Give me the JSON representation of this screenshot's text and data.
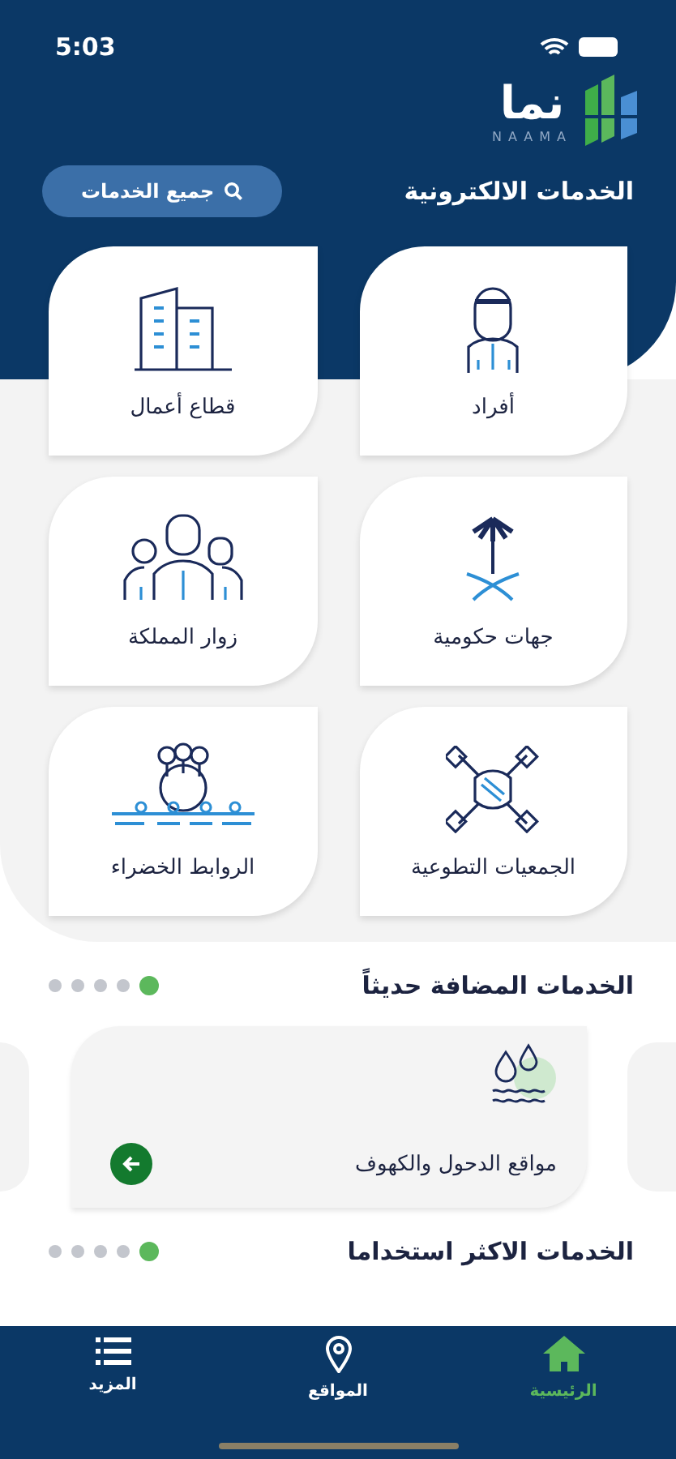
{
  "status_bar": {
    "time": "5:03"
  },
  "logo": {
    "arabic": "نما",
    "latin": "NAAMA"
  },
  "eservices": {
    "title": "الخدمات الالكترونية",
    "all_button": "جميع الخدمات"
  },
  "categories": [
    {
      "label": "أفراد",
      "kind": "person"
    },
    {
      "label": "قطاع أعمال",
      "kind": "building"
    },
    {
      "label": "جهات حكومية",
      "kind": "emblem"
    },
    {
      "label": "زوار المملكة",
      "kind": "family"
    },
    {
      "label": "الجمعيات التطوعية",
      "kind": "hands"
    },
    {
      "label": "الروابط الخضراء",
      "kind": "trees"
    }
  ],
  "new_services": {
    "title": "الخدمات المضافة حديثاً",
    "pages": [
      {
        "selected": true
      },
      {
        "selected": false
      },
      {
        "selected": false
      },
      {
        "selected": false
      },
      {
        "selected": false
      }
    ],
    "cards": [
      {
        "title": "مواقع الدحول والكهوف"
      }
    ]
  },
  "most_used": {
    "title": "الخدمات الاكثر استخداما",
    "pages": [
      {
        "selected": true
      },
      {
        "selected": false
      },
      {
        "selected": false
      },
      {
        "selected": false
      },
      {
        "selected": false
      }
    ]
  },
  "tabs": [
    {
      "label": "الرئيسية",
      "kind": "home",
      "selected": true
    },
    {
      "label": "المواقع",
      "kind": "pin",
      "selected": false
    },
    {
      "label": "المزيد",
      "kind": "list",
      "selected": false
    }
  ]
}
